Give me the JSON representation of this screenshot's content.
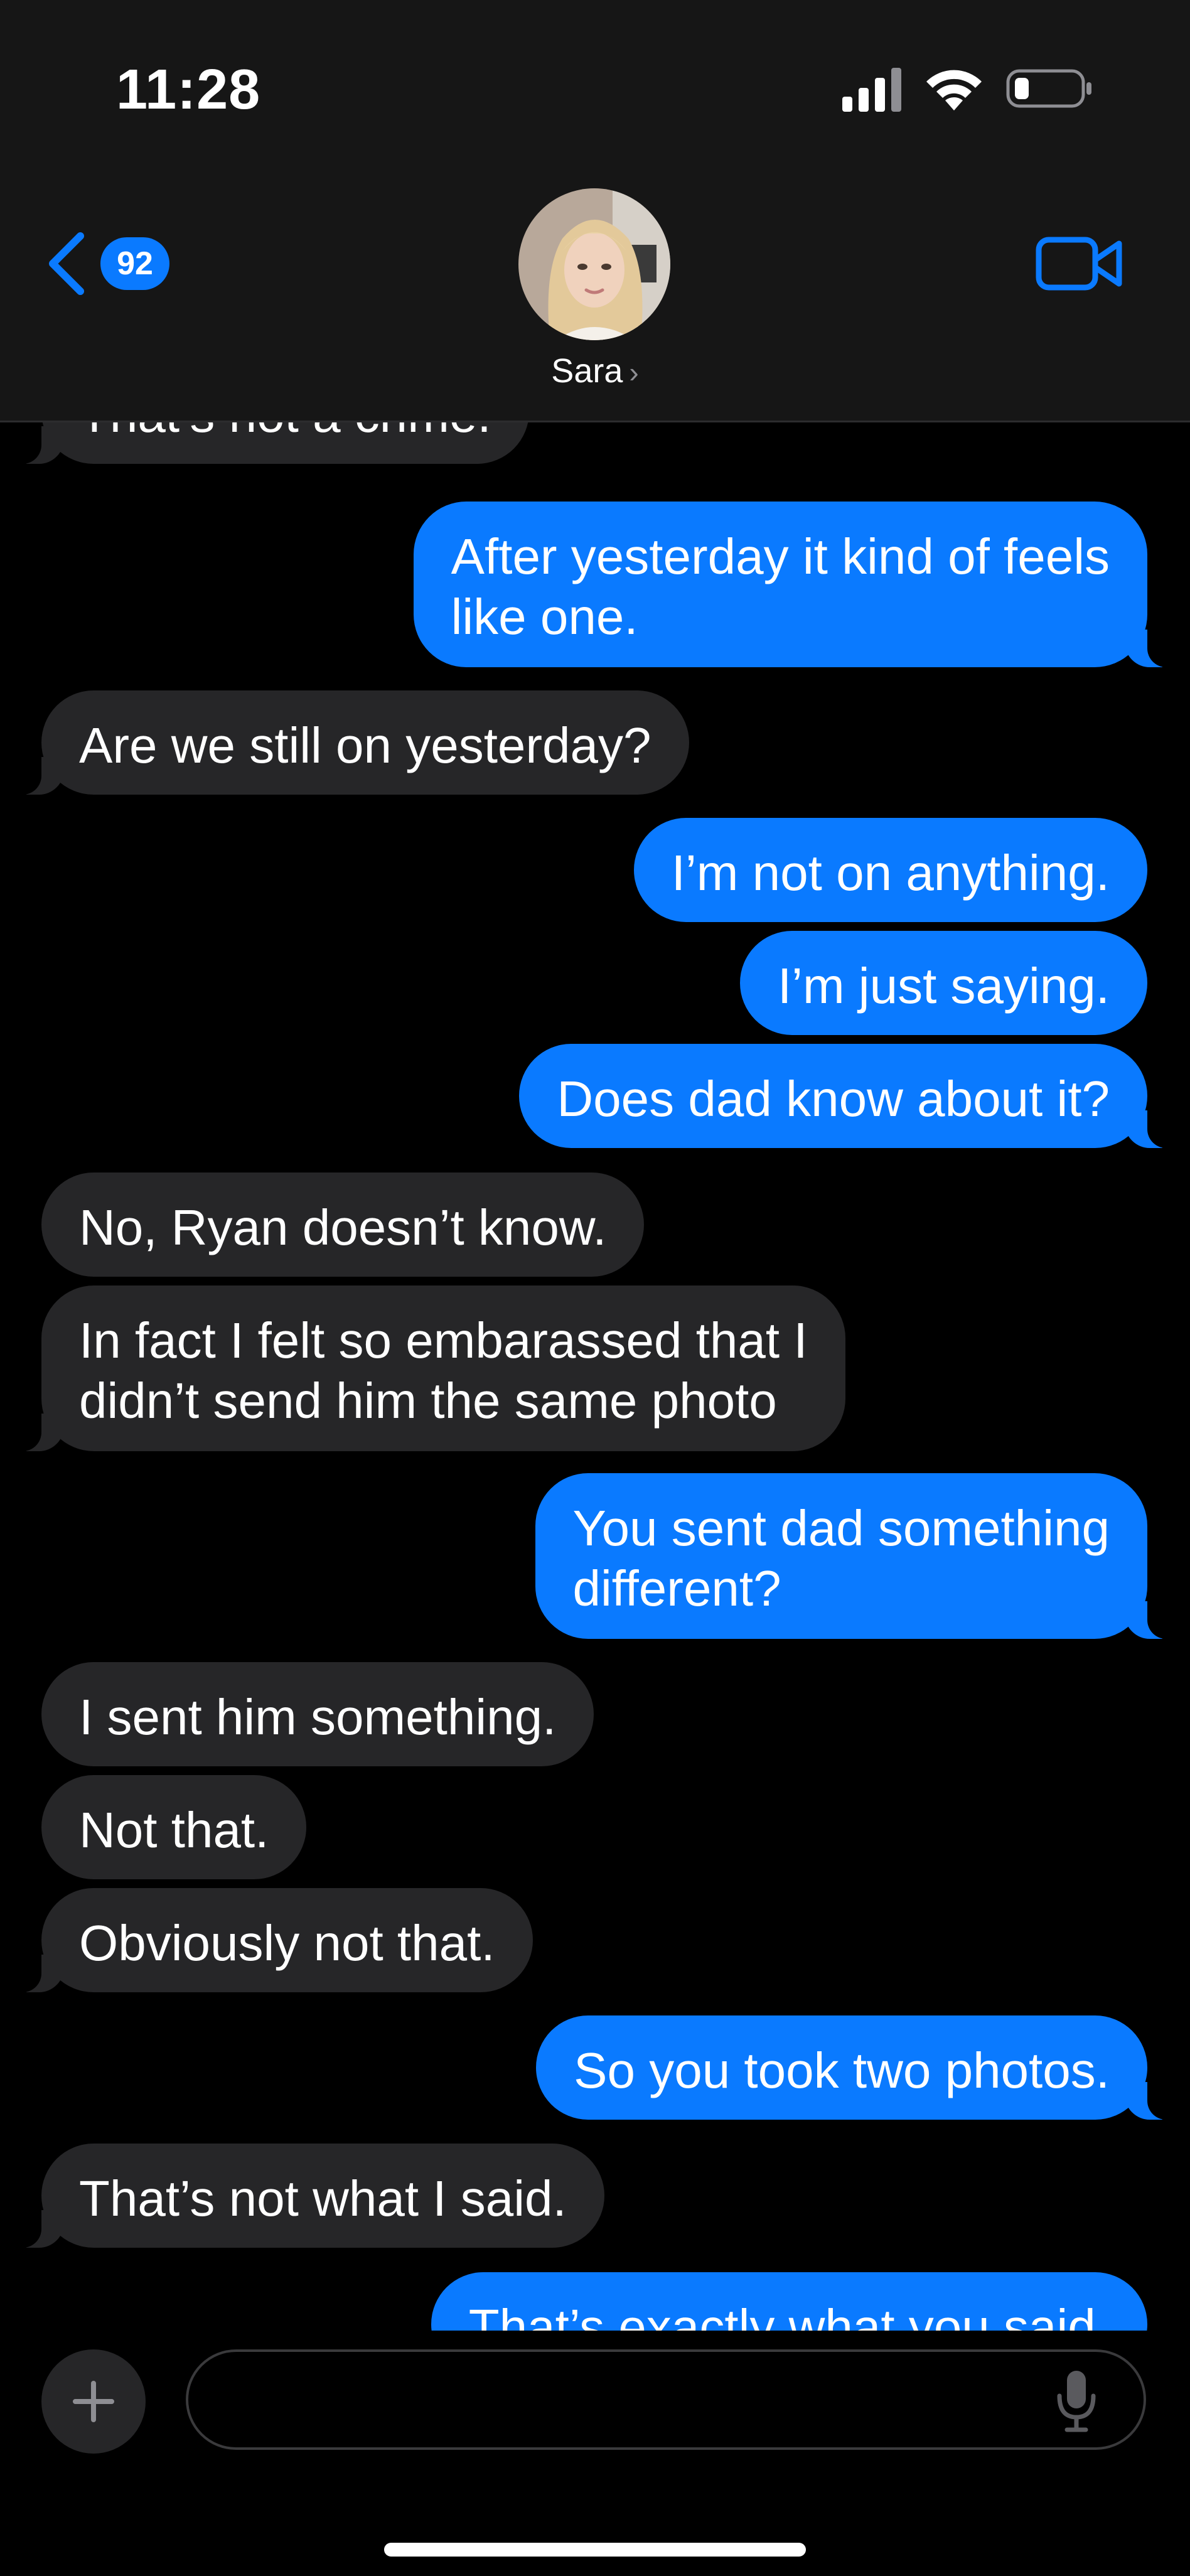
{
  "status_bar": {
    "time": "11:28",
    "icons": [
      "cellular-signal-icon",
      "wifi-icon",
      "battery-low-icon"
    ]
  },
  "header": {
    "back_badge_count": "92",
    "contact_name": "Sara",
    "icons": [
      "chevron-left-icon",
      "chevron-right-icon",
      "video-camera-icon"
    ],
    "accent_color": "#0a7aff"
  },
  "messages": [
    {
      "from": "contact",
      "text": "That’s not a crime."
    },
    {
      "from": "me",
      "lines": [
        "After yesterday it kind of feels",
        "like one."
      ]
    },
    {
      "from": "contact",
      "text": "Are we still on yesterday?"
    },
    {
      "from": "me",
      "text": "I’m not on anything."
    },
    {
      "from": "me",
      "text": "I’m just saying."
    },
    {
      "from": "me",
      "text": "Does dad know about it?"
    },
    {
      "from": "contact",
      "text": "No, Ryan doesn’t know."
    },
    {
      "from": "contact",
      "lines": [
        "In fact I felt so embarassed that I",
        "didn’t send him the same photo"
      ]
    },
    {
      "from": "me",
      "lines": [
        "You sent dad something",
        "different?"
      ]
    },
    {
      "from": "contact",
      "text": "I sent him something."
    },
    {
      "from": "contact",
      "text": "Not that."
    },
    {
      "from": "contact",
      "text": "Obviously not that."
    },
    {
      "from": "me",
      "text": "So you took two photos."
    },
    {
      "from": "contact",
      "text": "That’s not what I said."
    },
    {
      "from": "me",
      "text": "That’s exactly what you said."
    }
  ],
  "composer": {
    "placeholder": "",
    "icons": [
      "plus-icon",
      "microphone-icon"
    ]
  },
  "colors": {
    "sent_bubble": "#0a7aff",
    "received_bubble": "#262628",
    "background": "#000000",
    "header_background": "#161616"
  }
}
